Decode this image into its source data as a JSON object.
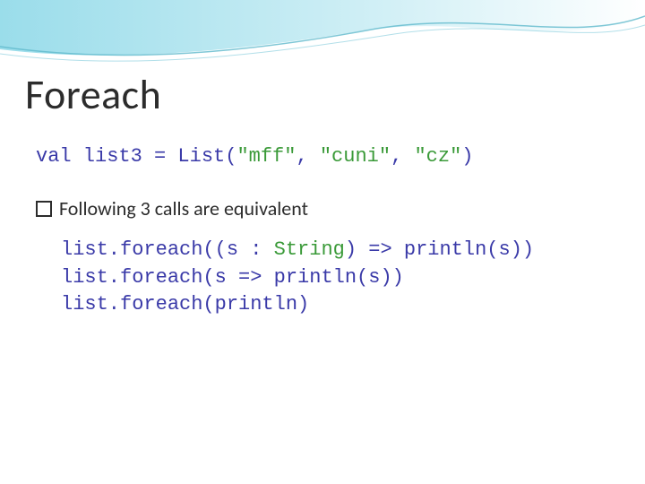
{
  "title": "Foreach",
  "decl": {
    "pre": "val list3 = List(",
    "s1": "\"mff\"",
    "c1": ", ",
    "s2": "\"cuni\"",
    "c2": ", ",
    "s3": "\"cz\"",
    "post": ")"
  },
  "body_text": "Following 3 calls are equivalent",
  "calls": {
    "line1": {
      "a": "list.foreach((s : ",
      "t": "String",
      "b": ") => println(s))"
    },
    "line2": "list.foreach(s => println(s))",
    "line3": "list.foreach(println)"
  }
}
